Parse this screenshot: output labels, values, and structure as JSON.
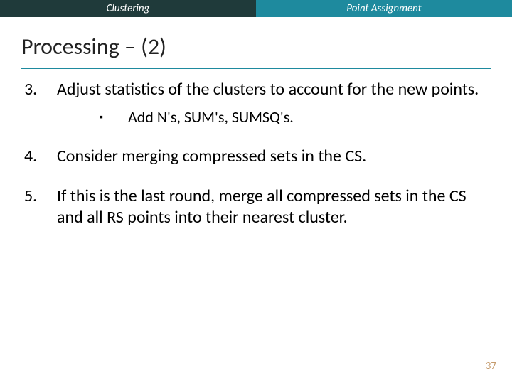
{
  "topbar": {
    "left": "Clustering",
    "right": "Point Assignment"
  },
  "title": "Processing – (2)",
  "items": [
    {
      "num": "3.",
      "text": "Adjust statistics of the clusters to account for the new points.",
      "sub": {
        "bullet": "▪",
        "text": "Add N's, SUM's, SUMSQ's."
      }
    },
    {
      "num": "4.",
      "text": "Consider merging compressed sets in the CS."
    },
    {
      "num": "5.",
      "text": "If this is the last round, merge all compressed sets in the CS and all RS points into their nearest cluster."
    }
  ],
  "page": "37"
}
